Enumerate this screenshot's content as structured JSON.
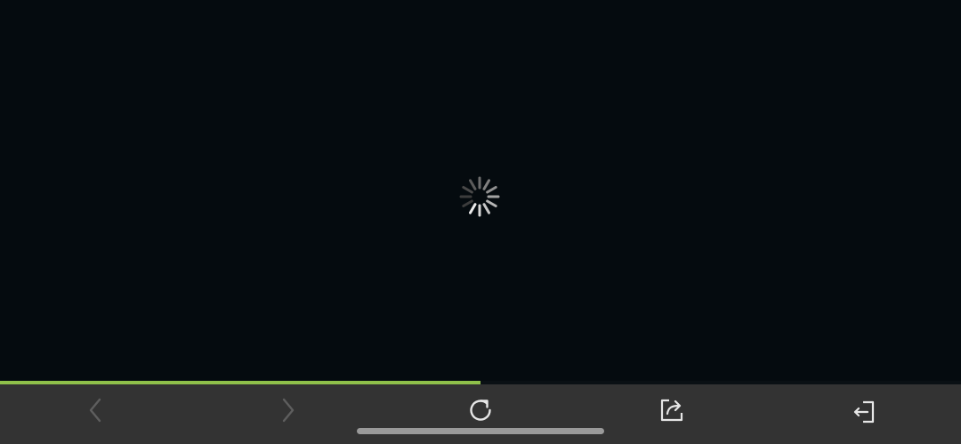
{
  "page": {
    "state": "loading"
  },
  "progress": {
    "value": 0.5,
    "color": "#8fc04a"
  },
  "toolbar": {
    "background": "#333333",
    "buttons": [
      {
        "name": "back",
        "icon": "chevron-left-icon",
        "enabled": false
      },
      {
        "name": "forward",
        "icon": "chevron-right-icon",
        "enabled": false
      },
      {
        "name": "reload",
        "icon": "reload-icon",
        "enabled": true
      },
      {
        "name": "share",
        "icon": "share-icon",
        "enabled": true
      },
      {
        "name": "exit",
        "icon": "exit-icon",
        "enabled": true
      }
    ]
  },
  "colors": {
    "content_background": "#050b0f",
    "icon_enabled": "#e6e6e6",
    "icon_disabled": "#5e5e5e"
  }
}
